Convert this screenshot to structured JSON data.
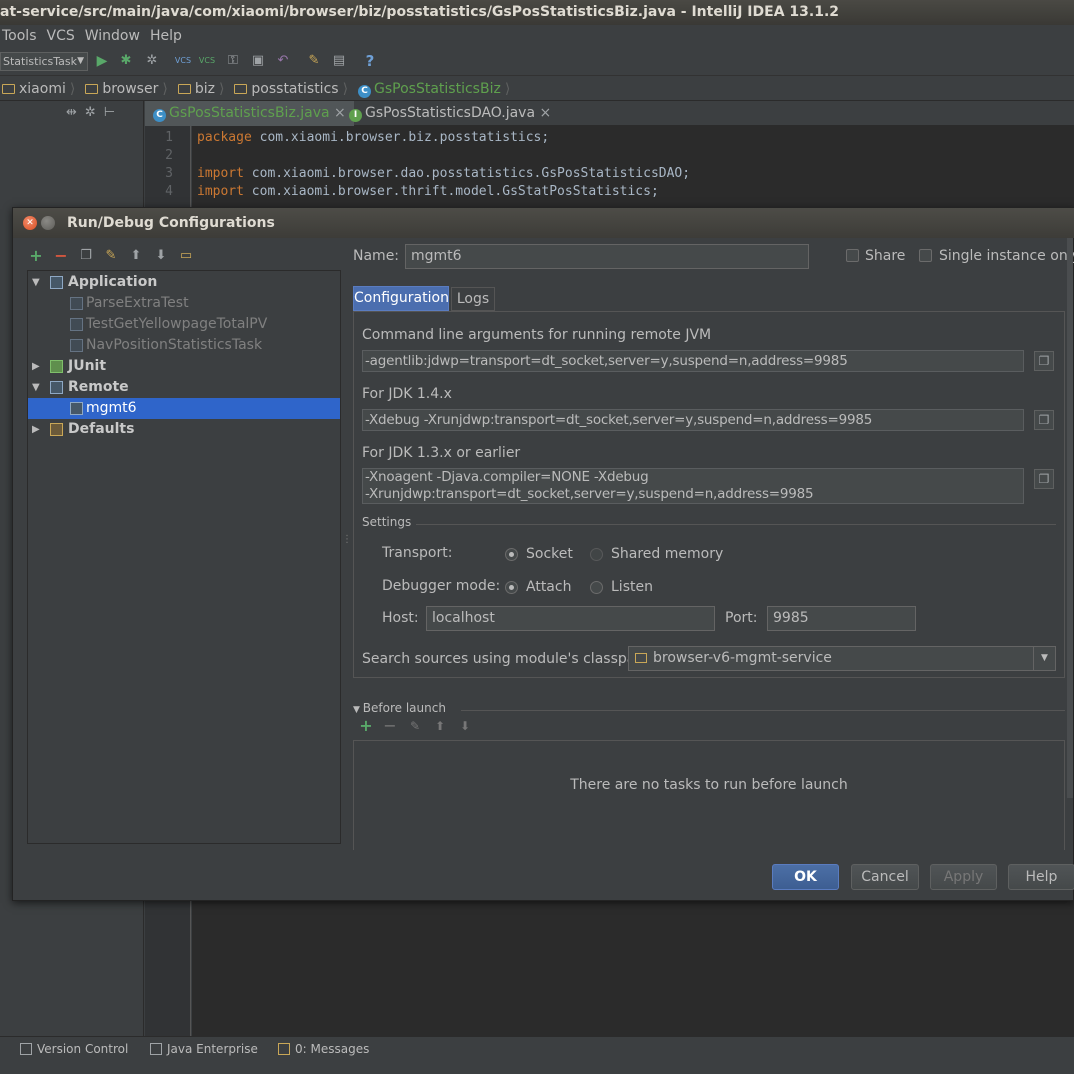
{
  "window": {
    "title": "at-service/src/main/java/com/xiaomi/browser/biz/posstatistics/GsPosStatisticsBiz.java - IntelliJ IDEA 13.1.2"
  },
  "menu": [
    "Tools",
    "VCS",
    "Window",
    "Help"
  ],
  "toolbar": {
    "run_config": "StatisticsTask"
  },
  "breadcrumbs": [
    "xiaomi",
    "browser",
    "biz",
    "posstatistics",
    "GsPosStatisticsBiz"
  ],
  "editor_tabs": [
    {
      "label": "GsPosStatisticsBiz.java",
      "close": "×"
    },
    {
      "label": "GsPosStatisticsDAO.java",
      "close": "×"
    }
  ],
  "code": {
    "line_numbers": [
      "1",
      "2",
      "3",
      "4"
    ],
    "line1_kw": "package",
    "line1": " com.xiaomi.browser.biz.posstatistics;",
    "line3_kw": "import",
    "line3": " com.xiaomi.browser.dao.posstatistics.GsPosStatisticsDAO;",
    "line4_kw": "import",
    "line4": " com.xiaomi.browser.thrift.model.GsStatPosStatistics;"
  },
  "status_bar": {
    "version_control": "Version Control",
    "java_enterprise": "Java Enterprise",
    "messages": "0: Messages"
  },
  "dialog": {
    "title": "Run/Debug Configurations",
    "tree": {
      "application": "Application",
      "app_items": [
        "ParseExtraTest",
        "TestGetYellowpageTotalPV",
        "NavPositionStatisticsTask"
      ],
      "junit": "JUnit",
      "remote": "Remote",
      "remote_item": "mgmt6",
      "defaults": "Defaults"
    },
    "name_label": "Name:",
    "name_value": "mgmt6",
    "share_label": "Share",
    "single_instance_label": "Single instance only",
    "tabs": {
      "configuration": "Configuration",
      "logs": "Logs"
    },
    "cmdline_label": "Command line arguments for running remote JVM",
    "cmdline_value": "-agentlib:jdwp=transport=dt_socket,server=y,suspend=n,address=9985",
    "jdk14_label": "For JDK 1.4.x",
    "jdk14_value": "-Xdebug -Xrunjdwp:transport=dt_socket,server=y,suspend=n,address=9985",
    "jdk13_label": "For JDK 1.3.x or earlier",
    "jdk13_value_1": "-Xnoagent -Djava.compiler=NONE -Xdebug",
    "jdk13_value_2": "-Xrunjdwp:transport=dt_socket,server=y,suspend=n,address=9985",
    "settings_label": "Settings",
    "transport_label": "Transport:",
    "socket_label": "Socket",
    "shared_memory_label": "Shared memory",
    "debugger_mode_label": "Debugger mode:",
    "attach_label": "Attach",
    "listen_label": "Listen",
    "host_label": "Host:",
    "host_value": "localhost",
    "port_label": "Port:",
    "port_value": "9985",
    "search_sources_label": "Search sources using module's classpath:",
    "module_value": "browser-v6-mgmt-service",
    "before_launch_label": "Before launch",
    "no_tasks": "There are no tasks to run before launch",
    "buttons": {
      "ok": "OK",
      "cancel": "Cancel",
      "apply": "Apply",
      "help": "Help"
    }
  }
}
